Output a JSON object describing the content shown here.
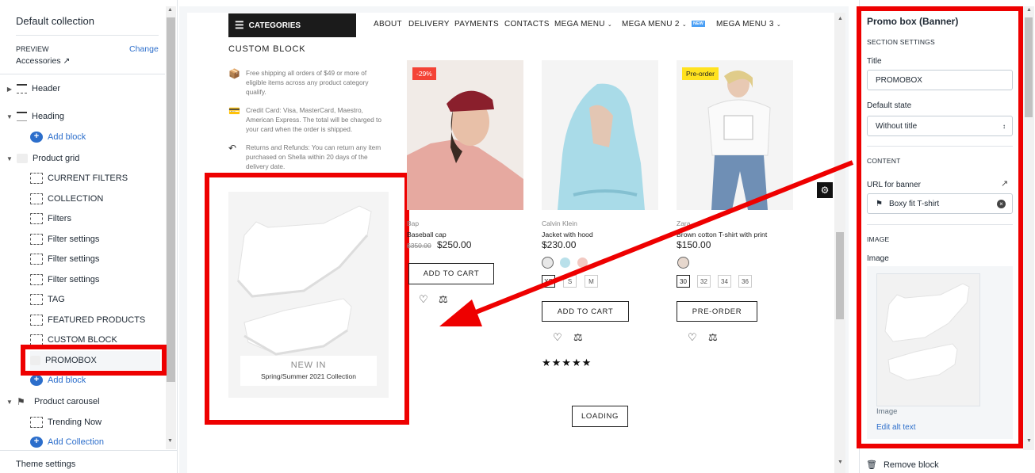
{
  "left_panel": {
    "title": "Default collection",
    "preview_label": "PREVIEW",
    "preview_value": "Accessories",
    "change_link": "Change",
    "items": [
      {
        "label": "Header"
      },
      {
        "label": "Heading"
      },
      {
        "label": "Add block"
      },
      {
        "label": "Product grid"
      },
      {
        "label": "CURRENT FILTERS"
      },
      {
        "label": "COLLECTION"
      },
      {
        "label": "Filters"
      },
      {
        "label": "Filter settings"
      },
      {
        "label": "Filter settings"
      },
      {
        "label": "Filter settings"
      },
      {
        "label": "TAG"
      },
      {
        "label": "FEATURED PRODUCTS"
      },
      {
        "label": "CUSTOM BLOCK"
      },
      {
        "label": "PROMOBOX"
      },
      {
        "label": "Add block"
      },
      {
        "label": "Product carousel"
      },
      {
        "label": "Trending Now"
      },
      {
        "label": "Add Collection"
      }
    ],
    "theme_settings": "Theme settings"
  },
  "store": {
    "categories_label": "CATEGORIES",
    "nav": [
      "ABOUT",
      "DELIVERY",
      "PAYMENTS",
      "CONTACTS",
      "MEGA MENU",
      "MEGA MENU 2",
      "MEGA MENU 3"
    ],
    "new_badge": "NEW",
    "custom_block_title": "CUSTOM BLOCK",
    "custom_block_items": [
      "Free shipping all orders of $49 or more of eligible items across any product category qualify.",
      "Credit Card: Visa, MasterCard, Maestro, American Express. The total will be charged to your card when the order is shipped.",
      "Returns and Refunds: You can return any item purchased on Shella within 20 days of the delivery date."
    ],
    "promobox": {
      "title": "NEW IN",
      "subtitle": "Spring/Summer 2021 Collection"
    },
    "products": [
      {
        "badge": "-29%",
        "brand": "Bap",
        "name": "Baseball cap",
        "old_price": "$350.00",
        "price": "$250.00",
        "button": "ADD TO CART"
      },
      {
        "badge": "",
        "brand": "Calvin Klein",
        "name": "Jacket with hood",
        "old_price": "",
        "price": "$230.00",
        "sizes": [
          "XS",
          "S",
          "M"
        ],
        "button": "ADD TO CART",
        "stars": "★★★★★"
      },
      {
        "badge": "Pre-order",
        "brand": "Zara",
        "name": "Brown cotton T-shirt with print",
        "old_price": "",
        "price": "$150.00",
        "sizes": [
          "30",
          "32",
          "34",
          "36"
        ],
        "button": "PRE-ORDER"
      }
    ],
    "loading_label": "LOADING"
  },
  "right_panel": {
    "title": "Promo box (Banner)",
    "section_settings": "SECTION SETTINGS",
    "title_label": "Title",
    "title_value": "PROMOBOX",
    "default_state_label": "Default state",
    "default_state_value": "Without title",
    "content_label": "CONTENT",
    "url_label": "URL for banner",
    "url_value": "Boxy fit T-shirt",
    "image_section": "IMAGE",
    "image_label": "Image",
    "image_caption": "Image",
    "edit_alt": "Edit alt text",
    "remove_block": "Remove block"
  },
  "colors": {
    "accent": "#2c6ecb",
    "highlight": "#e00000",
    "badge_sale": "#f44336",
    "badge_preorder": "#ffe21f"
  }
}
